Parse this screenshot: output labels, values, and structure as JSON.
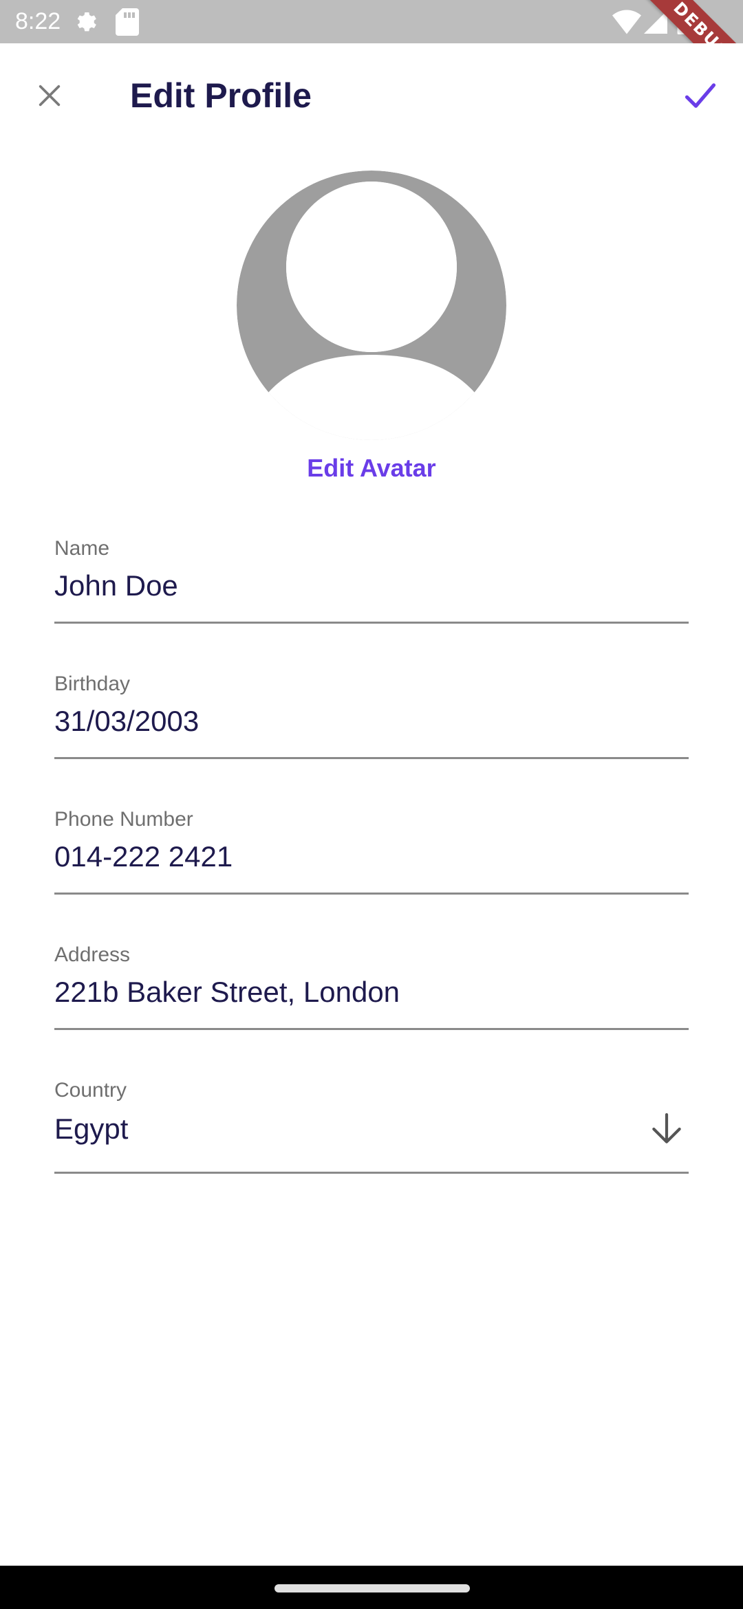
{
  "status_bar": {
    "time": "8:22",
    "debug_label": "DEBUG"
  },
  "app_bar": {
    "title": "Edit Profile",
    "close_icon": "close-icon",
    "confirm_icon": "check-icon",
    "accent_color": "#6a3de8"
  },
  "avatar": {
    "edit_label": "Edit Avatar",
    "icon": "person-placeholder-icon"
  },
  "form": {
    "name": {
      "label": "Name",
      "value": "John Doe"
    },
    "birthday": {
      "label": "Birthday",
      "value": "31/03/2003"
    },
    "phone": {
      "label": "Phone Number",
      "value": "014-222 2421"
    },
    "address": {
      "label": "Address",
      "value": "221b Baker Street, London"
    },
    "country": {
      "label": "Country",
      "value": "Egypt",
      "icon": "arrow-down-icon"
    }
  }
}
